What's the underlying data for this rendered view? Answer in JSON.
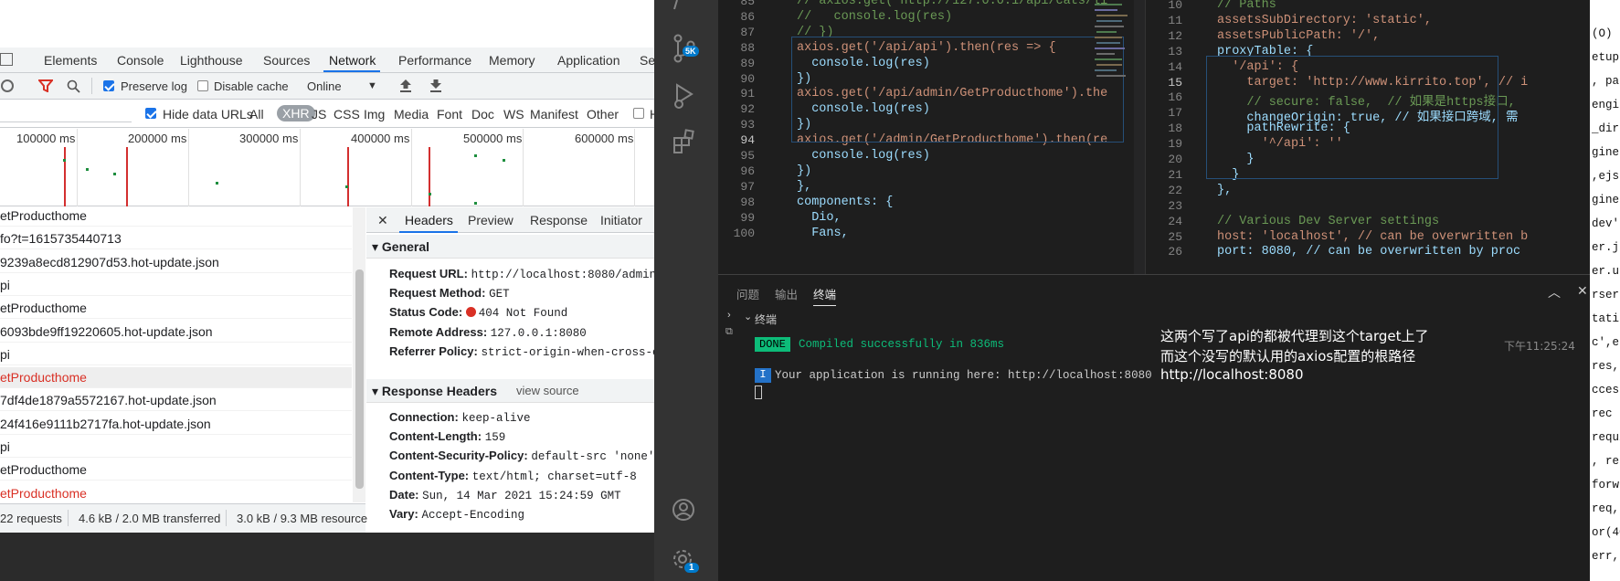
{
  "devtools": {
    "tabs": [
      "Elements",
      "Console",
      "Lighthouse",
      "Sources",
      "Network",
      "Performance",
      "Memory",
      "Application",
      "Se"
    ],
    "active_tab": "Network",
    "toolbar": {
      "preserve_log": "Preserve log",
      "disable_cache": "Disable cache",
      "throttle": "Online"
    },
    "filter": {
      "hide_data_urls": "Hide data URLs",
      "types": [
        "All",
        "XHR",
        "JS",
        "CSS",
        "Img",
        "Media",
        "Font",
        "Doc",
        "WS",
        "Manifest",
        "Other"
      ],
      "active_type": "XHR",
      "extra": "H"
    },
    "timeline_labels": [
      "100000 ms",
      "200000 ms",
      "300000 ms",
      "400000 ms",
      "500000 ms",
      "600000 ms"
    ],
    "requests": [
      {
        "name": "etProducthome",
        "error": false,
        "selected": false
      },
      {
        "name": "fo?t=1615735440713",
        "error": false,
        "selected": false
      },
      {
        "name": "9239a8ecd812907d53.hot-update.json",
        "error": false,
        "selected": false
      },
      {
        "name": "pi",
        "error": false,
        "selected": false
      },
      {
        "name": "etProducthome",
        "error": false,
        "selected": false
      },
      {
        "name": "6093bde9ff19220605.hot-update.json",
        "error": false,
        "selected": false
      },
      {
        "name": "pi",
        "error": false,
        "selected": false
      },
      {
        "name": "etProducthome",
        "error": true,
        "selected": true
      },
      {
        "name": "7df4de1879a5572167.hot-update.json",
        "error": false,
        "selected": false
      },
      {
        "name": "24f416e9111b2717fa.hot-update.json",
        "error": false,
        "selected": false
      },
      {
        "name": "pi",
        "error": false,
        "selected": false
      },
      {
        "name": "etProducthome",
        "error": false,
        "selected": false
      },
      {
        "name": "etProducthome",
        "error": true,
        "selected": false
      }
    ],
    "details": {
      "tabs": [
        "Headers",
        "Preview",
        "Response",
        "Initiator"
      ],
      "close": "✕",
      "general_title": "General",
      "general": [
        {
          "key": "Request URL:",
          "value": "http://localhost:8080/admin/"
        },
        {
          "key": "Request Method:",
          "value": "GET"
        },
        {
          "key": "Status Code:",
          "value": "404 Not Found"
        },
        {
          "key": "Remote Address:",
          "value": "127.0.0.1:8080"
        },
        {
          "key": "Referrer Policy:",
          "value": "strict-origin-when-cross-o"
        }
      ],
      "response_headers_title": "Response Headers",
      "view_source": "view source",
      "response_headers": [
        {
          "key": "Connection:",
          "value": "keep-alive"
        },
        {
          "key": "Content-Length:",
          "value": "159"
        },
        {
          "key": "Content-Security-Policy:",
          "value": "default-src 'none'"
        },
        {
          "key": "Content-Type:",
          "value": "text/html; charset=utf-8"
        },
        {
          "key": "Date:",
          "value": "Sun, 14 Mar 2021 15:24:59 GMT"
        },
        {
          "key": "Vary:",
          "value": "Accept-Encoding"
        }
      ]
    },
    "status": {
      "requests": "22 requests",
      "transferred": "4.6 kB / 2.0 MB transferred",
      "resources": "3.0 kB / 9.3 MB resource"
    }
  },
  "vscode": {
    "editor1": {
      "lines": [
        85,
        86,
        87,
        88,
        89,
        90,
        91,
        92,
        93,
        94,
        95,
        96,
        97,
        98,
        99,
        100
      ],
      "current_line": 94,
      "code": [
        "// axios.get('http://127.0.0.1/api/cats/li",
        "//   console.log(res)",
        "// })",
        "axios.get('/api/api').then(res => {",
        "  console.log(res)",
        "})",
        "axios.get('/api/admin/GetProducthome').the",
        "  console.log(res)",
        "})",
        "axios.get('/admin/GetProducthome').then(re",
        "  console.log(res)",
        "})",
        "},",
        "components: {",
        "  Dio,",
        "  Fans,"
      ]
    },
    "editor2": {
      "lines": [
        10,
        11,
        12,
        13,
        14,
        15,
        16,
        17,
        18,
        19,
        20,
        21,
        22,
        23,
        24,
        25,
        26
      ],
      "current_line": 15,
      "code": [
        "// Paths",
        "assetsSubDirectory: 'static',",
        "assetsPublicPath: '/',",
        "proxyTable: {",
        "  '/api': {",
        "    target: 'http://www.kirrito.top', // i",
        "    // secure: false,  // 如果是https接口,",
        "    changeOrigin: true, // 如果接口跨域, 需",
        "    pathRewrite: {",
        "      '^/api': ''",
        "    }",
        "  }",
        "},",
        "",
        "// Various Dev Server settings",
        "host: 'localhost', // can be overwritten b",
        "port: 8080, // can be overwritten by proc"
      ]
    },
    "panel": {
      "tabs": [
        "问题",
        "输出",
        "终端"
      ],
      "active_tab": "终端",
      "terminal_title": "终端",
      "done_badge": "DONE",
      "compiled": "Compiled successfully in 836ms",
      "time": "下午11:25:24",
      "info_badge": "I",
      "running": "Your application is running here: http://localhost:8080"
    },
    "annotation": [
      "这两个写了api的都被代理到这个target上了",
      "而这个没写的默认用的axios配置的根路径",
      "http://localhost:8080"
    ],
    "badge_count": "1",
    "scm_badge": "5K"
  },
  "right_strip": {
    "lines": [
      "(O)",
      "etup",
      ", pa",
      "engin",
      "_dir",
      "gine'",
      ",ejs",
      "gine'",
      "dev')",
      "er.js",
      "er.ur",
      "rser'",
      "tati",
      "c',e",
      "res,",
      "cces",
      "rec",
      "requi",
      ", re",
      "forw",
      "req,",
      "or(40",
      "err,"
    ]
  },
  "colors": {
    "vscode_bg": "#1e1e1e",
    "activity_bar": "#333333",
    "accent_blue": "#1a73e8",
    "error_red": "#d93025",
    "done_green": "#0dbc79"
  }
}
